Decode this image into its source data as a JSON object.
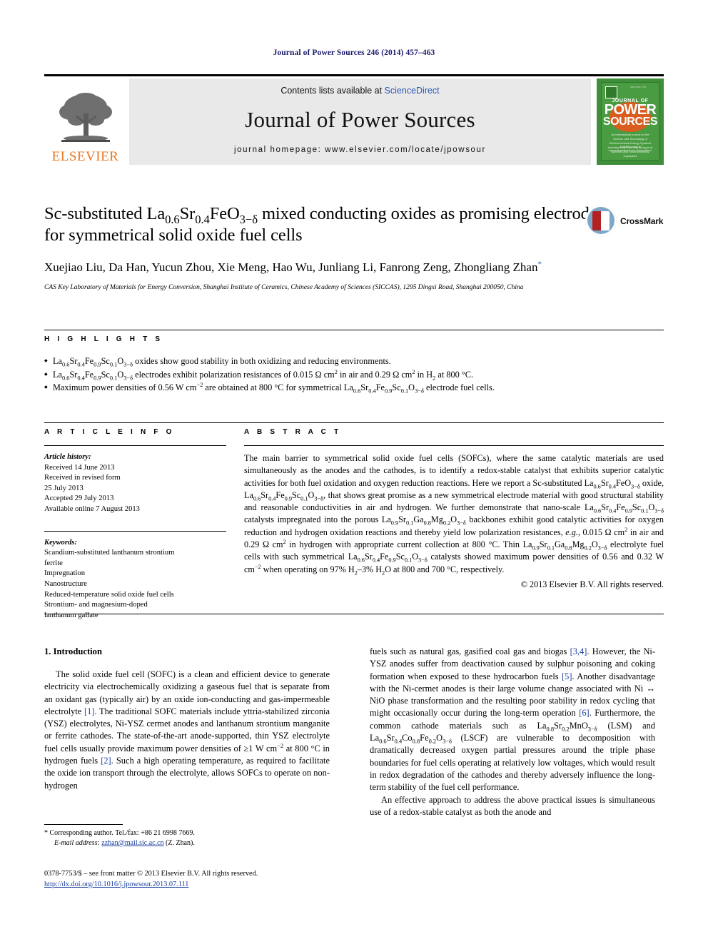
{
  "running_head": "Journal of Power Sources 246 (2014) 457–463",
  "masthead": {
    "contents_prefix": "Contents lists available at ",
    "contents_link": "ScienceDirect",
    "journal_title": "Journal of Power Sources",
    "homepage": "journal homepage: www.elsevier.com/locate/jpowsour",
    "publisher_logo_text": "ELSEVIER",
    "cover": {
      "line1": "JOURNAL OF",
      "line2": "POWER",
      "line3": "SOURCES",
      "blurb": "An international journal on the Science and Technology of Electrochemical Energy Systems including Fuel Cells and all types of Batteries and Electrochemical Capacitors",
      "foot": "Available online at www.sciencedirect.com\nScienceDirect"
    }
  },
  "article": {
    "title_html": "Sc-substituted La<sub>0.6</sub>Sr<sub>0.4</sub>FeO<sub>3−δ</sub> mixed conducting oxides as promising electrodes for symmetrical solid oxide fuel cells",
    "crossmark_label": "CrossMark",
    "authors_html": "Xuejiao Liu, Da Han, Yucun Zhou, Xie Meng, Hao Wu, Junliang Li, Fanrong Zeng, Zhongliang Zhan<sup>*</sup>",
    "affiliation": "CAS Key Laboratory of Materials for Energy Conversion, Shanghai Institute of Ceramics, Chinese Academy of Sciences (SICCAS), 1295 Dingxi Road, Shanghai 200050, China"
  },
  "highlights": {
    "heading": "H I G H L I G H T S",
    "items_html": [
      "La<sub>0.6</sub>Sr<sub>0.4</sub>Fe<sub>0.9</sub>Sc<sub>0.1</sub>O<sub>3−δ</sub> oxides show good stability in both oxidizing and reducing environments.",
      "La<sub>0.6</sub>Sr<sub>0.4</sub>Fe<sub>0.9</sub>Sc<sub>0.1</sub>O<sub>3−δ</sub> electrodes exhibit polarization resistances of 0.015 Ω cm<sup>2</sup> in air and 0.29 Ω cm<sup>2</sup> in H<sub>2</sub> at 800 °C.",
      "Maximum power densities of 0.56 W cm<sup>−2</sup> are obtained at 800 °C for symmetrical La<sub>0.6</sub>Sr<sub>0.4</sub>Fe<sub>0.9</sub>Sc<sub>0.1</sub>O<sub>3−δ</sub> electrode fuel cells."
    ]
  },
  "article_info": {
    "heading": "A R T I C L E    I N F O",
    "history_label": "Article history:",
    "history_lines": [
      "Received 14 June 2013",
      "Received in revised form",
      "25 July 2013",
      "Accepted 29 July 2013",
      "Available online 7 August 2013"
    ],
    "keywords_label": "Keywords:",
    "keywords": [
      "Scandium-substituted lanthanum strontium",
      "ferrite",
      "Impregnation",
      "Nanostructure",
      "Reduced-temperature solid oxide fuel cells",
      "Strontium- and magnesium-doped",
      "lanthanum gallate"
    ]
  },
  "abstract": {
    "heading": "A B S T R A C T",
    "body_html": "The main barrier to symmetrical solid oxide fuel cells (SOFCs), where the same catalytic materials are used simultaneously as the anodes and the cathodes, is to identify a redox-stable catalyst that exhibits superior catalytic activities for both fuel oxidation and oxygen reduction reactions. Here we report a Sc-substituted La<sub>0.6</sub>Sr<sub>0.4</sub>FeO<sub>3−δ</sub> oxide, La<sub>0.6</sub>Sr<sub>0.4</sub>Fe<sub>0.9</sub>Sc<sub>0.1</sub>O<sub>3−δ</sub>, that shows great promise as a new symmetrical electrode material with good structural stability and reasonable conductivities in air and hydrogen. We further demonstrate that nano-scale La<sub>0.6</sub>Sr<sub>0.4</sub>Fe<sub>0.9</sub>Sc<sub>0.1</sub>O<sub>3−δ</sub> catalysts impregnated into the porous La<sub>0.9</sub>Sr<sub>0.1</sub>Ga<sub>0.8</sub>Mg<sub>0.2</sub>O<sub>3−δ</sub> backbones exhibit good catalytic activities for oxygen reduction and hydrogen oxidation reactions and thereby yield low polarization resistances, <i>e.g.</i>, 0.015 Ω cm<sup>2</sup> in air and 0.29 Ω cm<sup>2</sup> in hydrogen with appropriate current collection at 800 °C. Thin La<sub>0.9</sub>Sr<sub>0.1</sub>Ga<sub>0.8</sub>Mg<sub>0.2</sub>O<sub>3−δ</sub> electrolyte fuel cells with such symmetrical La<sub>0.6</sub>Sr<sub>0.4</sub>Fe<sub>0.9</sub>Sc<sub>0.1</sub>O<sub>3−δ</sub> catalysts showed maximum power densities of 0.56 and 0.32 W cm<sup>−2</sup> when operating on 97% H<sub>2</sub>–3% H<sub>2</sub>O at 800 and 700 °C, respectively.",
    "copyright": "© 2013 Elsevier B.V. All rights reserved."
  },
  "introduction": {
    "heading": "1.  Introduction",
    "left_paragraph_html": "The solid oxide fuel cell (SOFC) is a clean and efficient device to generate electricity via electrochemically oxidizing a gaseous fuel that is separate from an oxidant gas (typically air) by an oxide ion-conducting and gas-impermeable electrolyte <span class=\"ref\">[1]</span>. The traditional SOFC materials include yttria-stabilized zirconia (YSZ) electrolytes, Ni-YSZ cermet anodes and lanthanum strontium manganite or ferrite cathodes. The state-of-the-art anode-supported, thin YSZ electrolyte fuel cells usually provide maximum power densities of ≥1 W cm<sup>−2</sup> at 800 °C in hydrogen fuels <span class=\"ref\">[2]</span>. Such a high operating temperature, as required to facilitate the oxide ion transport through the electrolyte, allows SOFCs to operate on non-hydrogen",
    "right_paragraph1_html": "fuels such as natural gas, gasified coal gas and biogas <span class=\"ref\">[3,4]</span>. However, the Ni-YSZ anodes suffer from deactivation caused by sulphur poisoning and coking formation when exposed to these hydrocarbon fuels <span class=\"ref\">[5]</span>. Another disadvantage with the Ni-cermet anodes is their large volume change associated with Ni ↔ NiO phase transformation and the resulting poor stability in redox cycling that might occasionally occur during the long-term operation <span class=\"ref\">[6]</span>. Furthermore, the common cathode materials such as La<sub>0.8</sub>Sr<sub>0.2</sub>MnO<sub>3−δ</sub> (LSM) and La<sub>0.6</sub>Sr<sub>0.4</sub>Co<sub>0.8</sub>Fe<sub>0.2</sub>O<sub>3−δ</sub> (LSCF) are vulnerable to decomposition with dramatically decreased oxygen partial pressures around the triple phase boundaries for fuel cells operating at relatively low voltages, which would result in redox degradation of the cathodes and thereby adversely influence the long-term stability of the fuel cell performance.",
    "right_paragraph2_html": "An effective approach to address the above practical issues is simultaneous use of a redox-stable catalyst as both the anode and"
  },
  "footnote": {
    "corresponding": "* Corresponding author. Tel./fax: +86 21 6998 7669.",
    "email_label": "E-mail address:",
    "email": "zzhan@mail.sic.ac.cn",
    "email_suffix": "(Z. Zhan)."
  },
  "imprint": {
    "line1": "0378-7753/$ – see front matter © 2013 Elsevier B.V. All rights reserved.",
    "doi": "http://dx.doi.org/10.1016/j.jpowsour.2013.07.111"
  },
  "colors": {
    "elsevier_orange": "#E87722",
    "link_blue": "#2b57b5",
    "ref_blue": "#1a3fa0",
    "cover_green": "#4a9c43",
    "crossmark_red": "#b22222"
  }
}
